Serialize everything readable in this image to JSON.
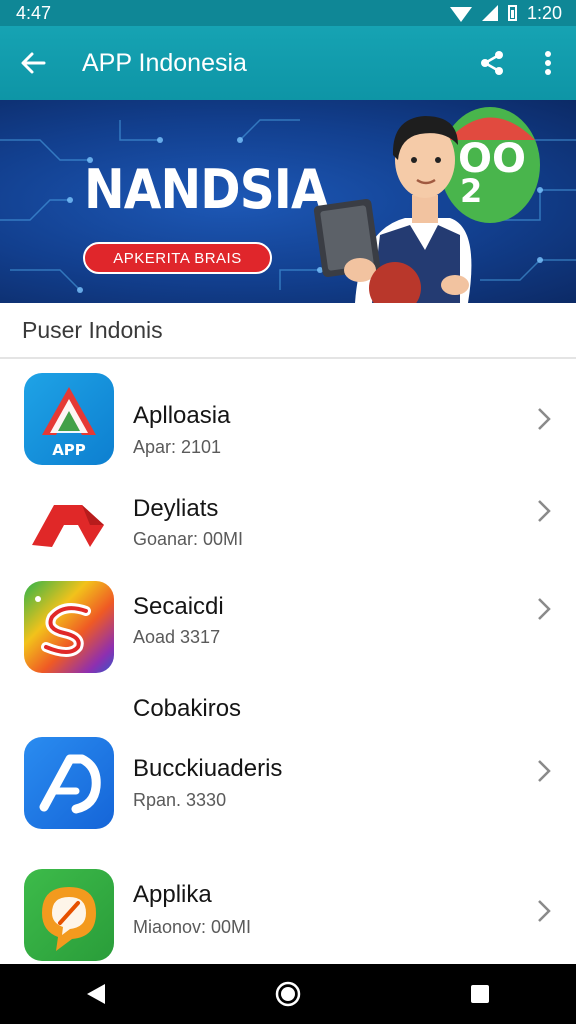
{
  "status": {
    "time": "4:47",
    "clock_right": "1:20"
  },
  "appbar": {
    "title": "APP Indonesia"
  },
  "banner": {
    "title": "NANDSIA",
    "pill": "APKERITA BRAIS",
    "bubble_top": "OO",
    "bubble_bottom": "2"
  },
  "section": {
    "header": "Puser Indonis"
  },
  "apps": [
    {
      "name": "Aplloasia",
      "meta": "Apar: 2101",
      "icon": "app-a-logo-icon",
      "icon_label": "APP"
    },
    {
      "name": "Deyliats",
      "meta": "Goanar: 00MI",
      "icon": "red-chevron-logo-icon"
    },
    {
      "name": "Secaicdi",
      "meta": "Aoad 3317",
      "icon": "colorful-s-logo-icon"
    },
    {
      "name": "Bucckiuaderis",
      "meta": "Rpan. 3330",
      "icon": "blue-a-logo-icon"
    },
    {
      "name": "Applika",
      "meta": "Miaonov: 00MI",
      "icon": "orange-chat-logo-icon"
    }
  ],
  "subheading": "Cobakiros",
  "colors": {
    "teal": "#16a3b3",
    "status_teal": "#0f8796",
    "banner_blue": "#123f8e",
    "pill_red": "#e0262b"
  }
}
